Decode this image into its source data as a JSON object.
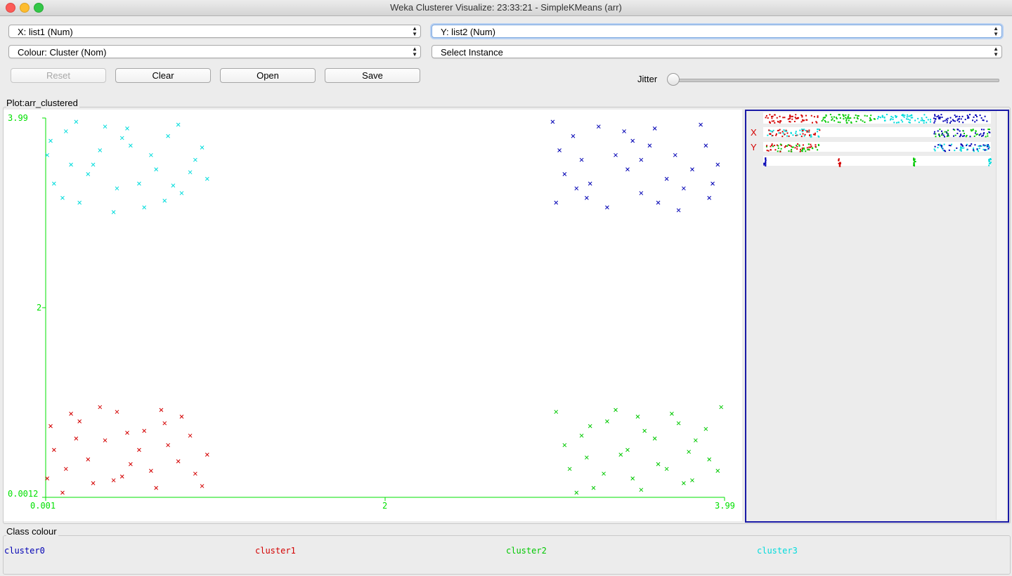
{
  "window": {
    "title": "Weka Clusterer Visualize: 23:33:21 - SimpleKMeans (arr)"
  },
  "controls": {
    "x_axis": "X: list1 (Num)",
    "y_axis": "Y: list2 (Num)",
    "colour": "Colour: Cluster (Nom)",
    "select_instance": "Select Instance",
    "reset": "Reset",
    "clear": "Clear",
    "open": "Open",
    "save": "Save",
    "jitter_label": "Jitter",
    "jitter_value": 0
  },
  "plot": {
    "title": "Plot:arr_clustered",
    "axis_color": "#00e000",
    "x_ticks": [
      "0.001",
      "2",
      "3.99"
    ],
    "y_ticks": [
      "3.99",
      "2",
      "0.0012"
    ],
    "matrix_labels": {
      "x": "X",
      "y": "Y"
    }
  },
  "chart_data": {
    "type": "scatter",
    "marker": "x",
    "xlim": [
      0.001,
      3.99
    ],
    "ylim": [
      0.0012,
      3.99
    ],
    "x_ticks": [
      "0.001",
      "2",
      "3.99"
    ],
    "y_ticks": [
      "3.99",
      "2",
      "0.0012"
    ],
    "series": [
      {
        "name": "cluster0",
        "color": "#0000b4",
        "points": [
          [
            2.98,
            3.95
          ],
          [
            3.1,
            3.8
          ],
          [
            3.25,
            3.9
          ],
          [
            3.4,
            3.85
          ],
          [
            3.55,
            3.7
          ],
          [
            3.7,
            3.6
          ],
          [
            3.85,
            3.92
          ],
          [
            3.95,
            3.5
          ],
          [
            3.05,
            3.4
          ],
          [
            3.2,
            3.3
          ],
          [
            3.35,
            3.6
          ],
          [
            3.5,
            3.2
          ],
          [
            3.65,
            3.35
          ],
          [
            3.8,
            3.45
          ],
          [
            3.9,
            3.15
          ],
          [
            3.0,
            3.1
          ],
          [
            3.15,
            3.55
          ],
          [
            3.3,
            3.05
          ],
          [
            3.45,
            3.75
          ],
          [
            3.6,
            3.1
          ],
          [
            3.75,
            3.25
          ],
          [
            3.88,
            3.7
          ],
          [
            3.02,
            3.65
          ],
          [
            3.18,
            3.15
          ],
          [
            3.42,
            3.45
          ],
          [
            3.58,
            3.88
          ],
          [
            3.72,
            3.02
          ],
          [
            3.92,
            3.3
          ],
          [
            3.12,
            3.25
          ],
          [
            3.5,
            3.55
          ]
        ]
      },
      {
        "name": "cluster1",
        "color": "#d40000",
        "points": [
          [
            0.01,
            0.2
          ],
          [
            0.05,
            0.5
          ],
          [
            0.12,
            0.3
          ],
          [
            0.2,
            0.8
          ],
          [
            0.28,
            0.15
          ],
          [
            0.35,
            0.6
          ],
          [
            0.42,
            0.9
          ],
          [
            0.5,
            0.35
          ],
          [
            0.58,
            0.7
          ],
          [
            0.65,
            0.1
          ],
          [
            0.72,
            0.55
          ],
          [
            0.8,
            0.85
          ],
          [
            0.88,
            0.25
          ],
          [
            0.95,
            0.45
          ],
          [
            0.03,
            0.75
          ],
          [
            0.1,
            0.05
          ],
          [
            0.18,
            0.62
          ],
          [
            0.25,
            0.4
          ],
          [
            0.32,
            0.95
          ],
          [
            0.4,
            0.18
          ],
          [
            0.48,
            0.68
          ],
          [
            0.55,
            0.5
          ],
          [
            0.62,
            0.28
          ],
          [
            0.7,
            0.78
          ],
          [
            0.78,
            0.38
          ],
          [
            0.85,
            0.65
          ],
          [
            0.92,
            0.12
          ],
          [
            0.15,
            0.88
          ],
          [
            0.45,
            0.22
          ],
          [
            0.68,
            0.92
          ]
        ]
      },
      {
        "name": "cluster2",
        "color": "#00c800",
        "points": [
          [
            3.0,
            0.9
          ],
          [
            3.08,
            0.3
          ],
          [
            3.15,
            0.65
          ],
          [
            3.22,
            0.1
          ],
          [
            3.3,
            0.8
          ],
          [
            3.38,
            0.45
          ],
          [
            3.45,
            0.2
          ],
          [
            3.52,
            0.7
          ],
          [
            3.6,
            0.35
          ],
          [
            3.68,
            0.88
          ],
          [
            3.75,
            0.15
          ],
          [
            3.82,
            0.6
          ],
          [
            3.9,
            0.4
          ],
          [
            3.97,
            0.95
          ],
          [
            3.05,
            0.55
          ],
          [
            3.12,
            0.05
          ],
          [
            3.2,
            0.75
          ],
          [
            3.28,
            0.25
          ],
          [
            3.35,
            0.92
          ],
          [
            3.42,
            0.5
          ],
          [
            3.5,
            0.08
          ],
          [
            3.58,
            0.62
          ],
          [
            3.65,
            0.3
          ],
          [
            3.72,
            0.78
          ],
          [
            3.8,
            0.18
          ],
          [
            3.88,
            0.72
          ],
          [
            3.95,
            0.28
          ],
          [
            3.18,
            0.42
          ],
          [
            3.48,
            0.85
          ],
          [
            3.78,
            0.48
          ]
        ]
      },
      {
        "name": "cluster3",
        "color": "#00dcdc",
        "points": [
          [
            0.01,
            3.6
          ],
          [
            0.05,
            3.3
          ],
          [
            0.12,
            3.85
          ],
          [
            0.2,
            3.1
          ],
          [
            0.28,
            3.5
          ],
          [
            0.35,
            3.9
          ],
          [
            0.42,
            3.25
          ],
          [
            0.5,
            3.7
          ],
          [
            0.58,
            3.05
          ],
          [
            0.65,
            3.45
          ],
          [
            0.72,
            3.8
          ],
          [
            0.8,
            3.2
          ],
          [
            0.88,
            3.55
          ],
          [
            0.95,
            3.35
          ],
          [
            0.03,
            3.75
          ],
          [
            0.1,
            3.15
          ],
          [
            0.18,
            3.95
          ],
          [
            0.25,
            3.4
          ],
          [
            0.32,
            3.65
          ],
          [
            0.4,
            3.0
          ],
          [
            0.48,
            3.88
          ],
          [
            0.55,
            3.3
          ],
          [
            0.62,
            3.6
          ],
          [
            0.7,
            3.12
          ],
          [
            0.78,
            3.92
          ],
          [
            0.85,
            3.42
          ],
          [
            0.92,
            3.68
          ],
          [
            0.15,
            3.5
          ],
          [
            0.45,
            3.78
          ],
          [
            0.75,
            3.28
          ]
        ]
      }
    ]
  },
  "class_colour": {
    "title": "Class colour",
    "items": [
      {
        "label": "cluster0",
        "color": "#0000b4"
      },
      {
        "label": "cluster1",
        "color": "#d40000"
      },
      {
        "label": "cluster2",
        "color": "#00c800"
      },
      {
        "label": "cluster3",
        "color": "#00dcdc"
      }
    ]
  }
}
